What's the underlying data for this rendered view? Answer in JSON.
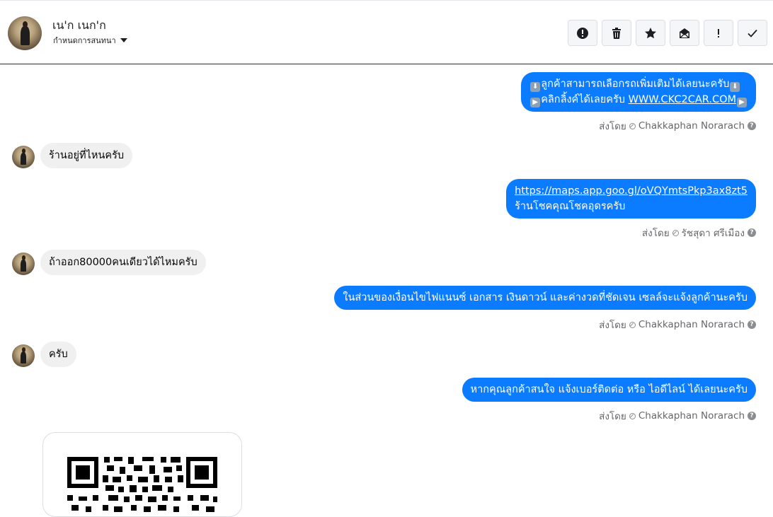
{
  "header": {
    "name": "เน'ก เนก'ก",
    "subtitle": "กำหนดการสนทนา",
    "toolbar": [
      {
        "name": "spam-alert-button",
        "icon": "alert-circle-icon"
      },
      {
        "name": "delete-button",
        "icon": "trash-icon"
      },
      {
        "name": "star-button",
        "icon": "star-icon"
      },
      {
        "name": "mark-unread-button",
        "icon": "envelope-open-icon"
      },
      {
        "name": "important-button",
        "icon": "exclamation-icon"
      },
      {
        "name": "done-button",
        "icon": "checkmark-icon"
      }
    ]
  },
  "messages": {
    "m1": {
      "emoji": "⬇",
      "line1": "ลูกค้าสามารถเลือกรถเพิ่มเติมได้เลยนะครับ",
      "emoji2": "▶",
      "line2": "คลิกลิ้งค์ได้เลยครับ ",
      "link": "WWW.CKC2CAR.COM",
      "sent_prefix": "ส่งโดย",
      "sender": "Chakkaphan Norarach"
    },
    "m2": {
      "text": "ร้านอยู่ที่ไหนครับ"
    },
    "m3": {
      "link": "https://maps.app.goo.gl/oVQYmtsPkp3ax8zt5",
      "line2": "ร้านโชคคุณโชคอุดรครับ",
      "sent_prefix": "ส่งโดย",
      "sender": "รัชสุดา ศรีเมือง"
    },
    "m4": {
      "text": "ถ้าออก80000คนเดียวได้ไหมครับ"
    },
    "m5": {
      "text": "ในส่วนของเงื่อนไขไฟแนนซ์ เอกสาร เงินดาวน์ และค่างวดที่ชัดเจน เซลล์จะแจ้งลูกค้านะครับ",
      "sent_prefix": "ส่งโดย",
      "sender": "Chakkaphan Norarach"
    },
    "m6": {
      "text": "ครับ"
    },
    "m7": {
      "text": "หากคุณลูกค้าสนใจ แจ้งเบอร์ติดต่อ หรือ ไอดีไลน์ ได้เลยนะครับ",
      "sent_prefix": "ส่งโดย",
      "sender": "Chakkaphan Norarach"
    }
  },
  "help_glyph": "?",
  "colors": {
    "outgoing": "#0b7bff",
    "incoming": "#f0f0f0",
    "meta": "#65676b"
  }
}
